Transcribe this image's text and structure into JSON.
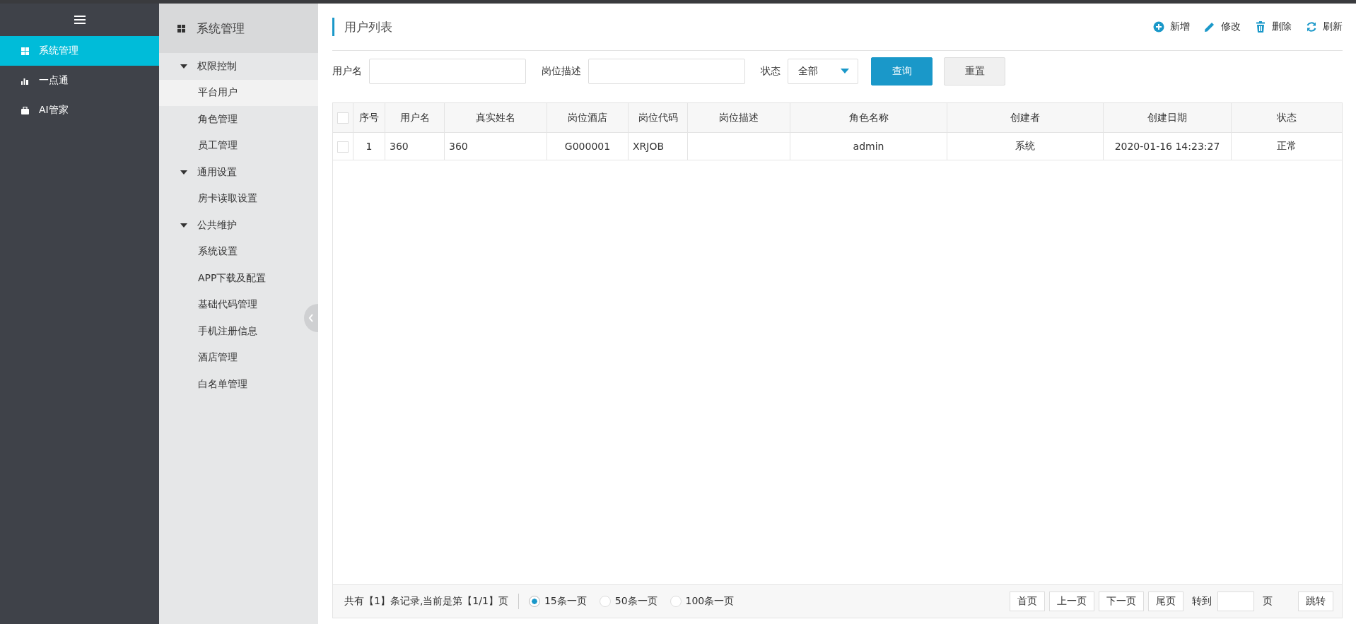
{
  "sidebar": {
    "items": [
      {
        "label": "系统管理",
        "kind": "grid",
        "selected": true
      },
      {
        "label": "一点通",
        "kind": "chart",
        "selected": false
      },
      {
        "label": "AI管家",
        "kind": "bag",
        "selected": false
      }
    ]
  },
  "submenu": {
    "title": "系统管理",
    "groups": [
      {
        "label": "权限控制",
        "expanded": true,
        "children": [
          {
            "label": "平台用户",
            "selected": true
          },
          {
            "label": "角色管理",
            "selected": false
          },
          {
            "label": "员工管理",
            "selected": false
          }
        ]
      },
      {
        "label": "通用设置",
        "expanded": true,
        "children": [
          {
            "label": "房卡读取设置",
            "selected": false
          }
        ]
      },
      {
        "label": "公共维护",
        "expanded": true,
        "children": [
          {
            "label": "系统设置",
            "selected": false
          },
          {
            "label": "APP下载及配置",
            "selected": false
          },
          {
            "label": "基础代码管理",
            "selected": false
          },
          {
            "label": "手机注册信息",
            "selected": false
          },
          {
            "label": "酒店管理",
            "selected": false
          },
          {
            "label": "白名单管理",
            "selected": false
          }
        ]
      }
    ]
  },
  "page": {
    "title": "用户列表"
  },
  "toolbar": [
    {
      "label": "新增",
      "kind": "add"
    },
    {
      "label": "修改",
      "kind": "edit"
    },
    {
      "label": "删除",
      "kind": "delete"
    },
    {
      "label": "刷新",
      "kind": "refresh"
    }
  ],
  "filters": {
    "fields": [
      {
        "label": "用户名",
        "kind": "text"
      },
      {
        "label": "岗位描述",
        "kind": "text"
      },
      {
        "label": "状态",
        "kind": "select",
        "value": "全部"
      }
    ],
    "buttons": [
      {
        "label": "查询",
        "kind": "primary"
      },
      {
        "label": "重置",
        "kind": "secondary"
      }
    ]
  },
  "table": {
    "header_checked": false,
    "columns": [
      "序号",
      "用户名",
      "真实姓名",
      "岗位酒店",
      "岗位代码",
      "岗位描述",
      "角色名称",
      "创建者",
      "创建日期",
      "状态"
    ],
    "rows": [
      {
        "checked": false,
        "cells": [
          "1",
          "360",
          "360",
          "G000001",
          "XRJOB",
          "",
          "admin",
          "系统",
          "2020-01-16 14:23:27",
          "正常"
        ]
      }
    ]
  },
  "footer": {
    "summary": "共有【1】条记录,当前是第【1/1】页",
    "page_sizes": [
      {
        "label": "15条一页",
        "selected": true
      },
      {
        "label": "50条一页",
        "selected": false
      },
      {
        "label": "100条一页",
        "selected": false
      }
    ],
    "nav": [
      "首页",
      "上一页",
      "下一页",
      "尾页"
    ],
    "goto_label": "转到",
    "page_unit": "页",
    "jump": "跳转"
  }
}
